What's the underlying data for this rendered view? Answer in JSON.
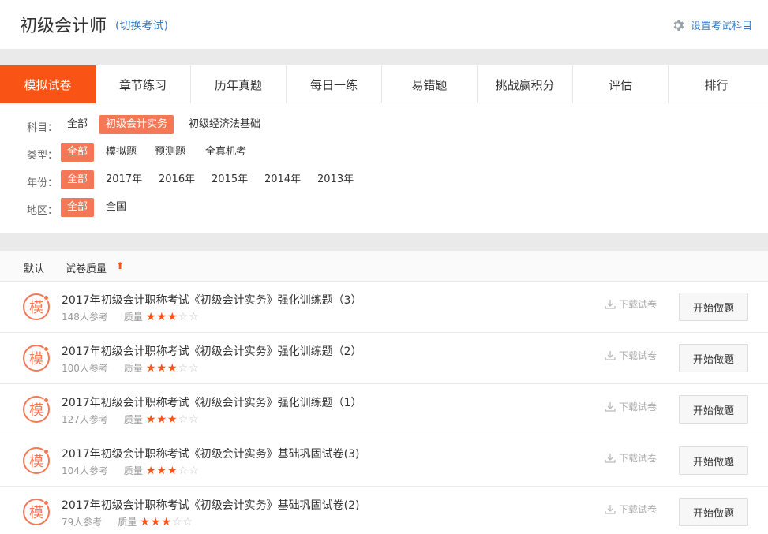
{
  "header": {
    "title": "初级会计师",
    "switch_label": "(切换考试)",
    "settings_label": "设置考试科目"
  },
  "tabs": [
    {
      "label": "模拟试卷",
      "active": true
    },
    {
      "label": "章节练习"
    },
    {
      "label": "历年真题"
    },
    {
      "label": "每日一练"
    },
    {
      "label": "易错题"
    },
    {
      "label": "挑战赢积分"
    },
    {
      "label": "评估"
    },
    {
      "label": "排行"
    }
  ],
  "filters": {
    "subject": {
      "label": "科目：",
      "options": [
        "全部",
        "初级会计实务",
        "初级经济法基础"
      ],
      "selected": 1
    },
    "type": {
      "label": "类型：",
      "options": [
        "全部",
        "模拟题",
        "预测题",
        "全真机考"
      ],
      "selected": 0
    },
    "year": {
      "label": "年份：",
      "options": [
        "全部",
        "2017年",
        "2016年",
        "2015年",
        "2014年",
        "2013年"
      ],
      "selected": 0
    },
    "region": {
      "label": "地区：",
      "options": [
        "全部",
        "全国"
      ],
      "selected": 0
    }
  },
  "sort": {
    "default_label": "默认",
    "quality_label": "试卷质量",
    "arrow": "⬆"
  },
  "list": {
    "icon_char": "模",
    "quality_label": "质量",
    "download_label": "下载试卷",
    "start_label": "开始做题",
    "items": [
      {
        "title": "2017年初级会计职称考试《初级会计实务》强化训练题（3）",
        "participants": "148人参考",
        "stars": 3
      },
      {
        "title": "2017年初级会计职称考试《初级会计实务》强化训练题（2）",
        "participants": "100人参考",
        "stars": 3
      },
      {
        "title": "2017年初级会计职称考试《初级会计实务》强化训练题（1）",
        "participants": "127人参考",
        "stars": 3
      },
      {
        "title": "2017年初级会计职称考试《初级会计实务》基础巩固试卷(3)",
        "participants": "104人参考",
        "stars": 3
      },
      {
        "title": "2017年初级会计职称考试《初级会计实务》基础巩固试卷(2)",
        "participants": "79人参考",
        "stars": 3
      }
    ]
  },
  "colors": {
    "accent": "#f95315",
    "selected_option": "#f47756",
    "link": "#3a7bbf"
  }
}
